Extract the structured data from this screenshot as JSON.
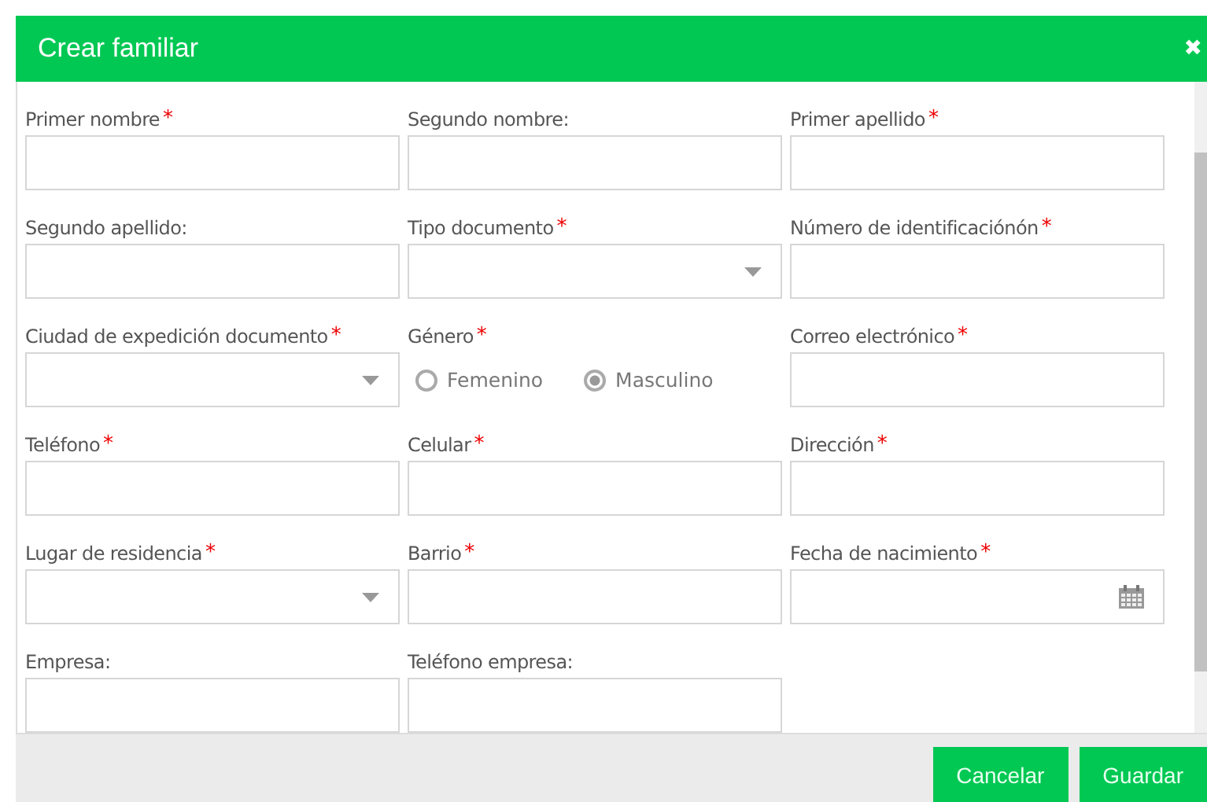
{
  "dialog": {
    "title": "Crear familiar",
    "close": "✖"
  },
  "fields": [
    {
      "kind": "text",
      "label": "Primer nombre",
      "mark": "*"
    },
    {
      "kind": "text",
      "label": "Segundo nombre:"
    },
    {
      "kind": "text",
      "label": "Primer apellido",
      "mark": "*"
    },
    {
      "kind": "text",
      "label": "Segundo apellido:"
    },
    {
      "kind": "select",
      "label": "Tipo documento",
      "mark": "*"
    },
    {
      "kind": "text",
      "label": "Número de identificaciónón",
      "mark": "*"
    },
    {
      "kind": "select",
      "label": "Ciudad de expedición documento",
      "mark": "*"
    },
    {
      "kind": "radio",
      "label": "Género",
      "mark": "*",
      "options": [
        {
          "label": "Femenino",
          "selected": false
        },
        {
          "label": "Masculino",
          "selected": true
        }
      ]
    },
    {
      "kind": "text",
      "label": "Correo electrónico",
      "mark": "*"
    },
    {
      "kind": "text",
      "label": "Teléfono",
      "mark": "*"
    },
    {
      "kind": "text",
      "label": "Celular",
      "mark": "*"
    },
    {
      "kind": "text",
      "label": "Dirección",
      "mark": "*"
    },
    {
      "kind": "select",
      "label": "Lugar de residencia",
      "mark": "*"
    },
    {
      "kind": "text",
      "label": "Barrio",
      "mark": "*"
    },
    {
      "kind": "date",
      "label": "Fecha de nacimiento",
      "mark": "*"
    },
    {
      "kind": "text",
      "label": "Empresa:"
    },
    {
      "kind": "text",
      "label": "Teléfono empresa:"
    }
  ],
  "buttons": [
    "Cancelar",
    "Guardar"
  ]
}
